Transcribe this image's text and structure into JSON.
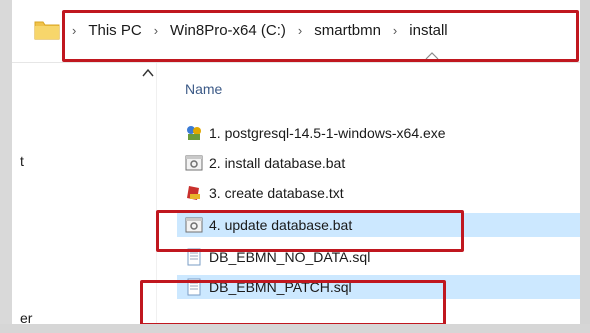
{
  "breadcrumb": [
    "This PC",
    "Win8Pro-x64 (C:)",
    "smartbmn",
    "install"
  ],
  "sort_indicator": "^",
  "column_header": "Name",
  "nav_items": [
    "t",
    "er"
  ],
  "files": [
    {
      "name": "1. postgresql-14.5-1-windows-x64.exe",
      "icon": "installer-icon",
      "selected": false
    },
    {
      "name": "2. install database.bat",
      "icon": "batch-file-icon",
      "selected": false
    },
    {
      "name": "3. create database.txt",
      "icon": "text-file-icon",
      "selected": false
    },
    {
      "name": "4. update database.bat",
      "icon": "batch-file-icon",
      "selected": true
    },
    {
      "name": "DB_EBMN_NO_DATA.sql",
      "icon": "sql-file-icon",
      "selected": false
    },
    {
      "name": "DB_EBMN_PATCH.sql",
      "icon": "sql-file-icon",
      "selected": true
    }
  ],
  "colors": {
    "highlight": "#c0171f",
    "selection": "#cce8ff",
    "header_text": "#3c5a87"
  }
}
